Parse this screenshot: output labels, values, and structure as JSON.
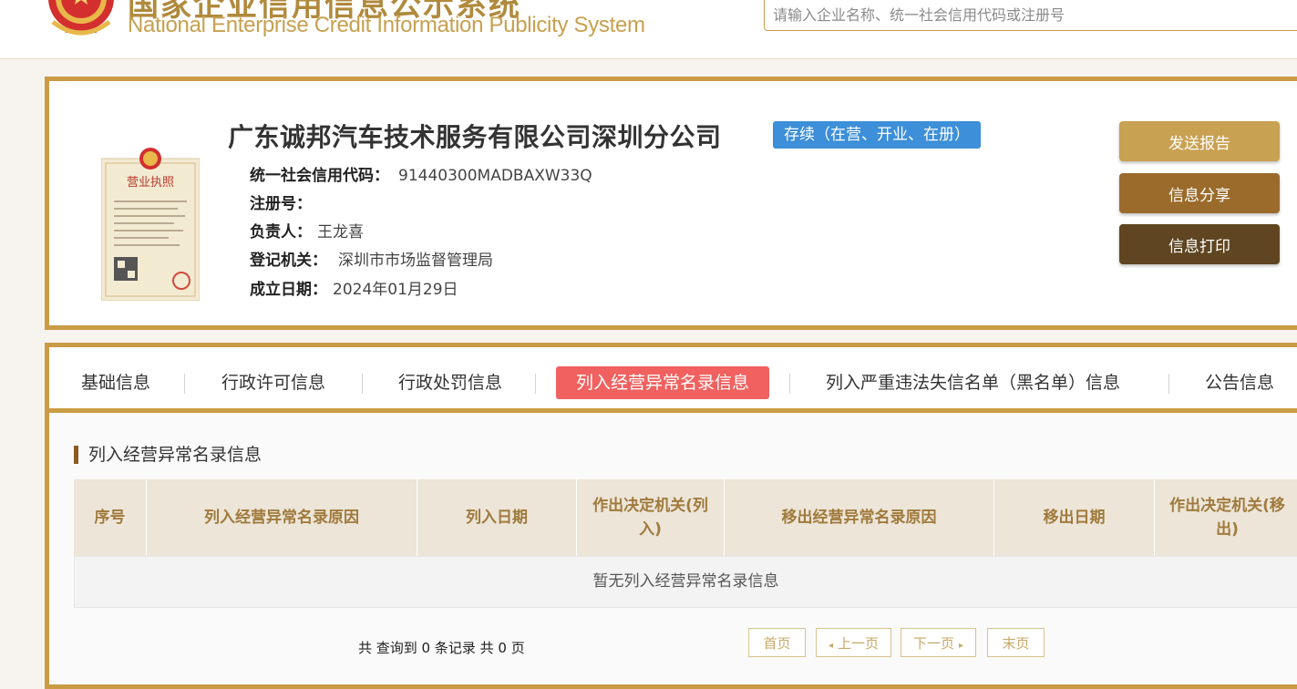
{
  "header": {
    "site_title": "国家企业信用信息公示系统",
    "site_subtitle": "National Enterprise Credit Information Publicity System",
    "search_placeholder": "请输入企业名称、统一社会信用代码或注册号"
  },
  "company": {
    "name": "广东诚邦汽车技术服务有限公司深圳分公司",
    "status": "存续（在营、开业、在册）",
    "fields": [
      {
        "label": "统一社会信用代码：",
        "value": "91440300MADBAXW33Q"
      },
      {
        "label": "注册号：",
        "value": ""
      },
      {
        "label": "负责人：",
        "value": "王龙喜"
      },
      {
        "label": "登记机关：",
        "value": "深圳市市场监督管理局"
      },
      {
        "label": "成立日期：",
        "value": "2024年01月29日"
      }
    ],
    "license_title": "营业执照"
  },
  "actions": {
    "send_report": "发送报告",
    "share": "信息分享",
    "print": "信息打印"
  },
  "tabs": [
    {
      "label": "基础信息"
    },
    {
      "label": "行政许可信息"
    },
    {
      "label": "行政处罚信息"
    },
    {
      "label": "列入经营异常名录信息"
    },
    {
      "label": "列入严重违法失信名单（黑名单）信息"
    },
    {
      "label": "公告信息"
    }
  ],
  "section": {
    "title": "列入经营异常名录信息",
    "columns": [
      "序号",
      "列入经营异常名录原因",
      "列入日期",
      "作出决定机关(列入)",
      "移出经营异常名录原因",
      "移出日期",
      "作出决定机关(移出)"
    ],
    "empty_text": "暂无列入经营异常名录信息"
  },
  "pagination": {
    "summary": "共 查询到 0 条记录 共 0 页",
    "first": "首页",
    "prev": "上一页",
    "next": "下一页",
    "last": "末页"
  },
  "colors": {
    "gold": "#c99b44",
    "active_tab": "#f0615f",
    "status_badge": "#3c8fd8",
    "btn_send": "#c9a152",
    "btn_share": "#9b6b2c",
    "btn_print": "#5f4521"
  }
}
